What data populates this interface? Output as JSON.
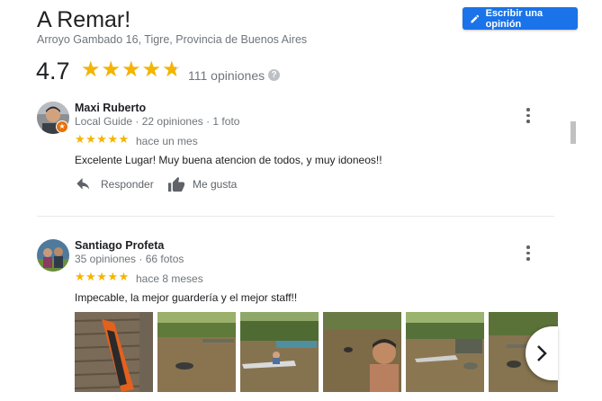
{
  "place": {
    "title": "A Remar!",
    "address": "Arroyo Gambado 16, Tigre, Provincia de Buenos Aires",
    "rating": "4.7",
    "rating_value": 4.7,
    "review_count": "111 opiniones"
  },
  "write_button": {
    "label": "Escribir una opinión",
    "icon": "pencil-icon"
  },
  "star_glyphs": "★★★★★",
  "colors": {
    "accent": "#1a73e8",
    "star": "#f4b400",
    "text_secondary": "#70757a"
  },
  "reviews": [
    {
      "name": "Maxi Ruberto",
      "meta": "Local Guide · 22 opiniones · 1 foto",
      "when": "hace un mes",
      "stars": 5,
      "text": "Excelente Lugar! Muy buena atencion de todos, y muy idoneos!!",
      "reply_label": "Responder",
      "like_label": "Me gusta"
    },
    {
      "name": "Santiago Profeta",
      "meta": "35 opiniones · 66 fotos",
      "when": "hace 8 meses",
      "stars": 5,
      "text": "Impecable, la mejor guardería y el mejor staff!!"
    }
  ]
}
